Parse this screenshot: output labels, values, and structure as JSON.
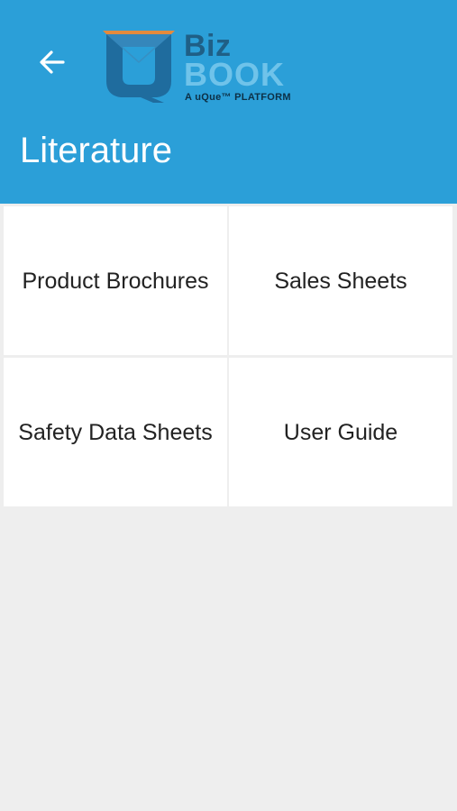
{
  "header": {
    "title": "Literature",
    "back_icon": "arrow-left-icon",
    "background": "#2b9fd8"
  },
  "logo": {
    "line1": "Biz",
    "line2": "BOOK",
    "tagline": "A uQue™ PLATFORM",
    "colors": {
      "biz": "#1f5f86",
      "book": "#6fc3ea",
      "mark": "#1f6c9e",
      "mark_accent": "#e58a3c"
    }
  },
  "tiles": [
    {
      "label": "Product Brochures"
    },
    {
      "label": "Sales Sheets"
    },
    {
      "label": "Safety Data Sheets"
    },
    {
      "label": "User Guide"
    }
  ]
}
